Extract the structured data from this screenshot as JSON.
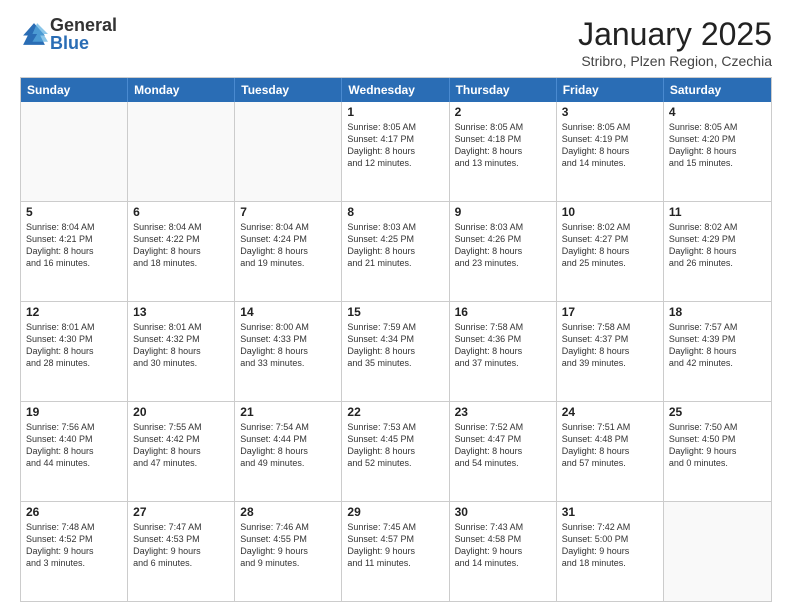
{
  "logo": {
    "general": "General",
    "blue": "Blue"
  },
  "header": {
    "title": "January 2025",
    "subtitle": "Stribro, Plzen Region, Czechia"
  },
  "weekdays": [
    "Sunday",
    "Monday",
    "Tuesday",
    "Wednesday",
    "Thursday",
    "Friday",
    "Saturday"
  ],
  "rows": [
    [
      {
        "day": "",
        "lines": [],
        "empty": true
      },
      {
        "day": "",
        "lines": [],
        "empty": true
      },
      {
        "day": "",
        "lines": [],
        "empty": true
      },
      {
        "day": "1",
        "lines": [
          "Sunrise: 8:05 AM",
          "Sunset: 4:17 PM",
          "Daylight: 8 hours",
          "and 12 minutes."
        ],
        "empty": false
      },
      {
        "day": "2",
        "lines": [
          "Sunrise: 8:05 AM",
          "Sunset: 4:18 PM",
          "Daylight: 8 hours",
          "and 13 minutes."
        ],
        "empty": false
      },
      {
        "day": "3",
        "lines": [
          "Sunrise: 8:05 AM",
          "Sunset: 4:19 PM",
          "Daylight: 8 hours",
          "and 14 minutes."
        ],
        "empty": false
      },
      {
        "day": "4",
        "lines": [
          "Sunrise: 8:05 AM",
          "Sunset: 4:20 PM",
          "Daylight: 8 hours",
          "and 15 minutes."
        ],
        "empty": false
      }
    ],
    [
      {
        "day": "5",
        "lines": [
          "Sunrise: 8:04 AM",
          "Sunset: 4:21 PM",
          "Daylight: 8 hours",
          "and 16 minutes."
        ],
        "empty": false
      },
      {
        "day": "6",
        "lines": [
          "Sunrise: 8:04 AM",
          "Sunset: 4:22 PM",
          "Daylight: 8 hours",
          "and 18 minutes."
        ],
        "empty": false
      },
      {
        "day": "7",
        "lines": [
          "Sunrise: 8:04 AM",
          "Sunset: 4:24 PM",
          "Daylight: 8 hours",
          "and 19 minutes."
        ],
        "empty": false
      },
      {
        "day": "8",
        "lines": [
          "Sunrise: 8:03 AM",
          "Sunset: 4:25 PM",
          "Daylight: 8 hours",
          "and 21 minutes."
        ],
        "empty": false
      },
      {
        "day": "9",
        "lines": [
          "Sunrise: 8:03 AM",
          "Sunset: 4:26 PM",
          "Daylight: 8 hours",
          "and 23 minutes."
        ],
        "empty": false
      },
      {
        "day": "10",
        "lines": [
          "Sunrise: 8:02 AM",
          "Sunset: 4:27 PM",
          "Daylight: 8 hours",
          "and 25 minutes."
        ],
        "empty": false
      },
      {
        "day": "11",
        "lines": [
          "Sunrise: 8:02 AM",
          "Sunset: 4:29 PM",
          "Daylight: 8 hours",
          "and 26 minutes."
        ],
        "empty": false
      }
    ],
    [
      {
        "day": "12",
        "lines": [
          "Sunrise: 8:01 AM",
          "Sunset: 4:30 PM",
          "Daylight: 8 hours",
          "and 28 minutes."
        ],
        "empty": false
      },
      {
        "day": "13",
        "lines": [
          "Sunrise: 8:01 AM",
          "Sunset: 4:32 PM",
          "Daylight: 8 hours",
          "and 30 minutes."
        ],
        "empty": false
      },
      {
        "day": "14",
        "lines": [
          "Sunrise: 8:00 AM",
          "Sunset: 4:33 PM",
          "Daylight: 8 hours",
          "and 33 minutes."
        ],
        "empty": false
      },
      {
        "day": "15",
        "lines": [
          "Sunrise: 7:59 AM",
          "Sunset: 4:34 PM",
          "Daylight: 8 hours",
          "and 35 minutes."
        ],
        "empty": false
      },
      {
        "day": "16",
        "lines": [
          "Sunrise: 7:58 AM",
          "Sunset: 4:36 PM",
          "Daylight: 8 hours",
          "and 37 minutes."
        ],
        "empty": false
      },
      {
        "day": "17",
        "lines": [
          "Sunrise: 7:58 AM",
          "Sunset: 4:37 PM",
          "Daylight: 8 hours",
          "and 39 minutes."
        ],
        "empty": false
      },
      {
        "day": "18",
        "lines": [
          "Sunrise: 7:57 AM",
          "Sunset: 4:39 PM",
          "Daylight: 8 hours",
          "and 42 minutes."
        ],
        "empty": false
      }
    ],
    [
      {
        "day": "19",
        "lines": [
          "Sunrise: 7:56 AM",
          "Sunset: 4:40 PM",
          "Daylight: 8 hours",
          "and 44 minutes."
        ],
        "empty": false
      },
      {
        "day": "20",
        "lines": [
          "Sunrise: 7:55 AM",
          "Sunset: 4:42 PM",
          "Daylight: 8 hours",
          "and 47 minutes."
        ],
        "empty": false
      },
      {
        "day": "21",
        "lines": [
          "Sunrise: 7:54 AM",
          "Sunset: 4:44 PM",
          "Daylight: 8 hours",
          "and 49 minutes."
        ],
        "empty": false
      },
      {
        "day": "22",
        "lines": [
          "Sunrise: 7:53 AM",
          "Sunset: 4:45 PM",
          "Daylight: 8 hours",
          "and 52 minutes."
        ],
        "empty": false
      },
      {
        "day": "23",
        "lines": [
          "Sunrise: 7:52 AM",
          "Sunset: 4:47 PM",
          "Daylight: 8 hours",
          "and 54 minutes."
        ],
        "empty": false
      },
      {
        "day": "24",
        "lines": [
          "Sunrise: 7:51 AM",
          "Sunset: 4:48 PM",
          "Daylight: 8 hours",
          "and 57 minutes."
        ],
        "empty": false
      },
      {
        "day": "25",
        "lines": [
          "Sunrise: 7:50 AM",
          "Sunset: 4:50 PM",
          "Daylight: 9 hours",
          "and 0 minutes."
        ],
        "empty": false
      }
    ],
    [
      {
        "day": "26",
        "lines": [
          "Sunrise: 7:48 AM",
          "Sunset: 4:52 PM",
          "Daylight: 9 hours",
          "and 3 minutes."
        ],
        "empty": false
      },
      {
        "day": "27",
        "lines": [
          "Sunrise: 7:47 AM",
          "Sunset: 4:53 PM",
          "Daylight: 9 hours",
          "and 6 minutes."
        ],
        "empty": false
      },
      {
        "day": "28",
        "lines": [
          "Sunrise: 7:46 AM",
          "Sunset: 4:55 PM",
          "Daylight: 9 hours",
          "and 9 minutes."
        ],
        "empty": false
      },
      {
        "day": "29",
        "lines": [
          "Sunrise: 7:45 AM",
          "Sunset: 4:57 PM",
          "Daylight: 9 hours",
          "and 11 minutes."
        ],
        "empty": false
      },
      {
        "day": "30",
        "lines": [
          "Sunrise: 7:43 AM",
          "Sunset: 4:58 PM",
          "Daylight: 9 hours",
          "and 14 minutes."
        ],
        "empty": false
      },
      {
        "day": "31",
        "lines": [
          "Sunrise: 7:42 AM",
          "Sunset: 5:00 PM",
          "Daylight: 9 hours",
          "and 18 minutes."
        ],
        "empty": false
      },
      {
        "day": "",
        "lines": [],
        "empty": true
      }
    ]
  ]
}
